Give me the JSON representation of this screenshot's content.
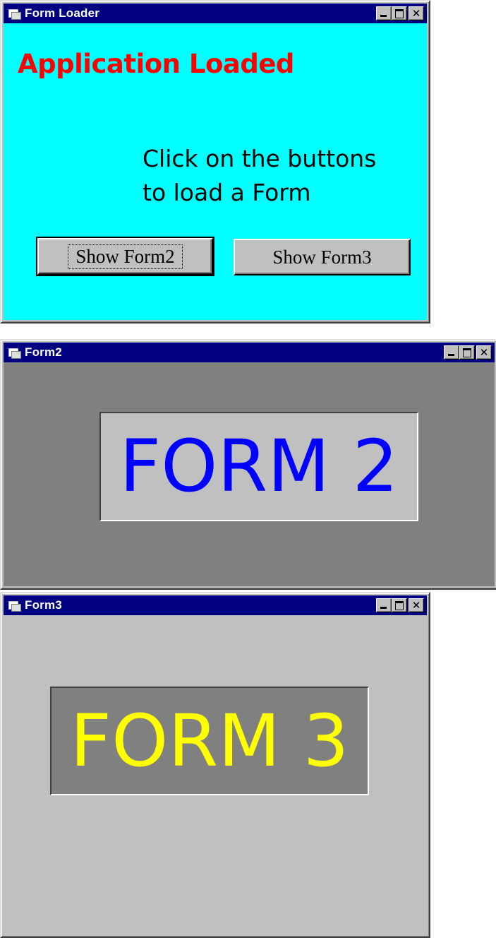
{
  "windows": {
    "form_loader": {
      "title": "Form Loader",
      "heading": "Application Loaded",
      "instructions_line1": "Click on the buttons",
      "instructions_line2": "to load a Form",
      "button_show_form2": "Show Form2",
      "button_show_form3": "Show Form3",
      "client_color": "#00ffff",
      "heading_color": "#ff0000"
    },
    "form2": {
      "title": "Form2",
      "label": "FORM 2",
      "client_color": "#808080",
      "label_bg": "#c0c0c0",
      "label_color": "#0000ff"
    },
    "form3": {
      "title": "Form3",
      "label": "FORM 3",
      "client_color": "#c0c0c0",
      "label_bg": "#808080",
      "label_color": "#ffff00"
    }
  },
  "titlebar": {
    "color": "#000080",
    "icons": [
      "app-icon",
      "minimize-icon",
      "maximize-icon",
      "close-icon"
    ],
    "close_glyph": "✕"
  }
}
